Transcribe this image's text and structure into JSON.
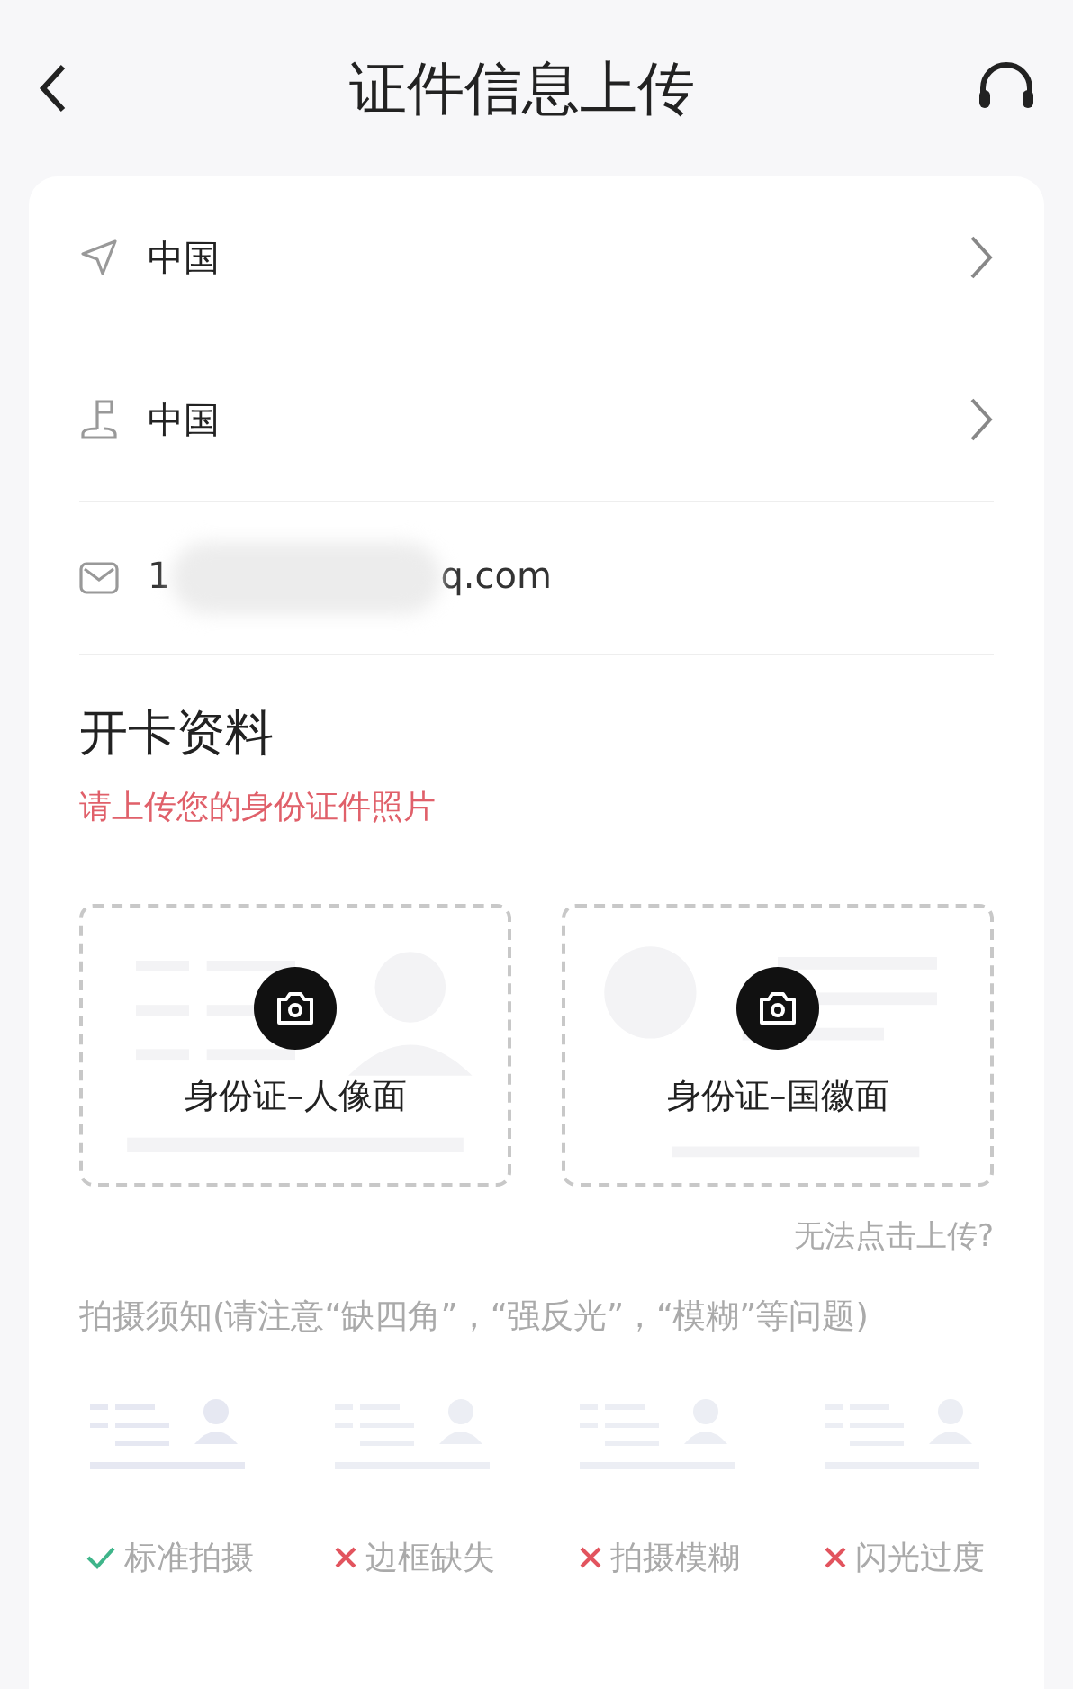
{
  "header": {
    "title": "证件信息上传"
  },
  "rows": [
    {
      "kind": "location",
      "value": "中国",
      "chevron": true
    },
    {
      "kind": "region",
      "value": "中国",
      "chevron": true
    }
  ],
  "email": {
    "value_start": "1",
    "value_end": "q.com",
    "redacted": true
  },
  "section": {
    "title": "开卡资料",
    "subtitle": "请上传您的身份证件照片"
  },
  "uploads": [
    {
      "kind": "portrait",
      "label": "身份证–人像面"
    },
    {
      "kind": "emblem",
      "label": "身份证–国徽面"
    }
  ],
  "help_link": "无法点击上传?",
  "notice": "拍摄须知(请注意“缺四角”，“强反光”，“模糊”等问题)",
  "examples": [
    {
      "label": "标准拍摄",
      "ok": true
    },
    {
      "label": "边框缺失",
      "ok": false
    },
    {
      "label": "拍摄模糊",
      "ok": false
    },
    {
      "label": "闪光过度",
      "ok": false
    }
  ]
}
